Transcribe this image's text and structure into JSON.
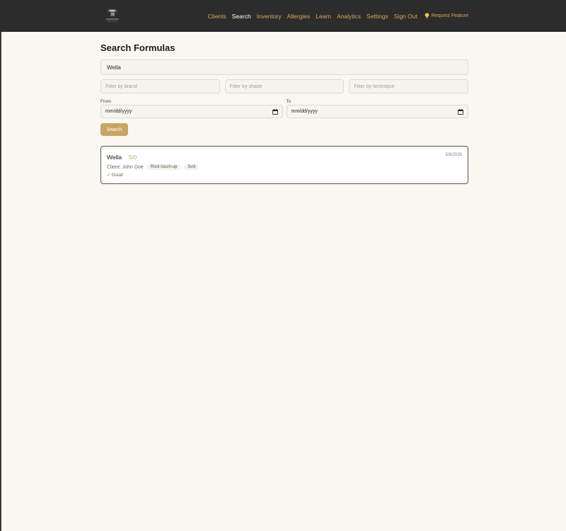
{
  "nav": {
    "items": [
      "Clients",
      "Search",
      "Inventory",
      "Allergies",
      "Learn",
      "Analytics",
      "Settings",
      "Sign Out"
    ],
    "active": "Search",
    "request_feature": "Request Feature"
  },
  "page": {
    "title": "Search Formulas"
  },
  "search": {
    "value": "Wella"
  },
  "filters": {
    "brand_placeholder": "Filter by brand",
    "shade_placeholder": "Filter by shade",
    "technique_placeholder": "Filter by technique"
  },
  "dates": {
    "from_label": "From",
    "to_label": "To",
    "from_value": "mm/dd/yyyy",
    "to_value": "mm/dd/yyyy"
  },
  "search_button": "Search",
  "results": [
    {
      "brand": "Wella",
      "shade": "5/0",
      "date": "5/6/2026",
      "client": "Client: John Doe",
      "tags": [
        "Root touch-up",
        "5vol"
      ],
      "note": "✓ Great!"
    }
  ],
  "colors": {
    "navbar": "#2c2c2c",
    "accent": "#d7a85a",
    "button": "#c8a565",
    "background": "#faf7f3"
  }
}
